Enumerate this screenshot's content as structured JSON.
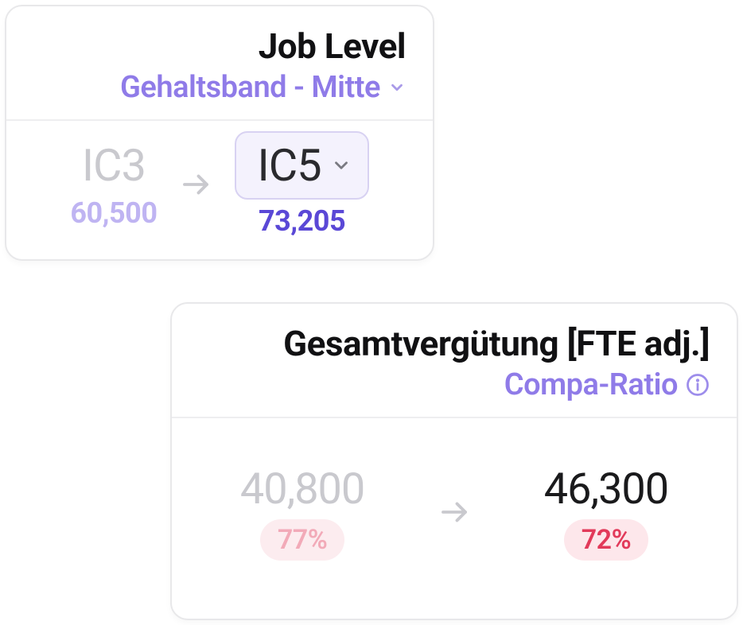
{
  "job_level_card": {
    "title": "Job Level",
    "subtitle": "Gehaltsband - Mitte",
    "old_level": "IC3",
    "old_salary": "60,500",
    "new_level": "IC5",
    "new_salary": "73,205"
  },
  "comp_card": {
    "title": "Gesamtvergütung [FTE adj.]",
    "subtitle": "Compa-Ratio",
    "old_value": "40,800",
    "old_ratio": "77%",
    "new_value": "46,300",
    "new_ratio": "72%"
  }
}
